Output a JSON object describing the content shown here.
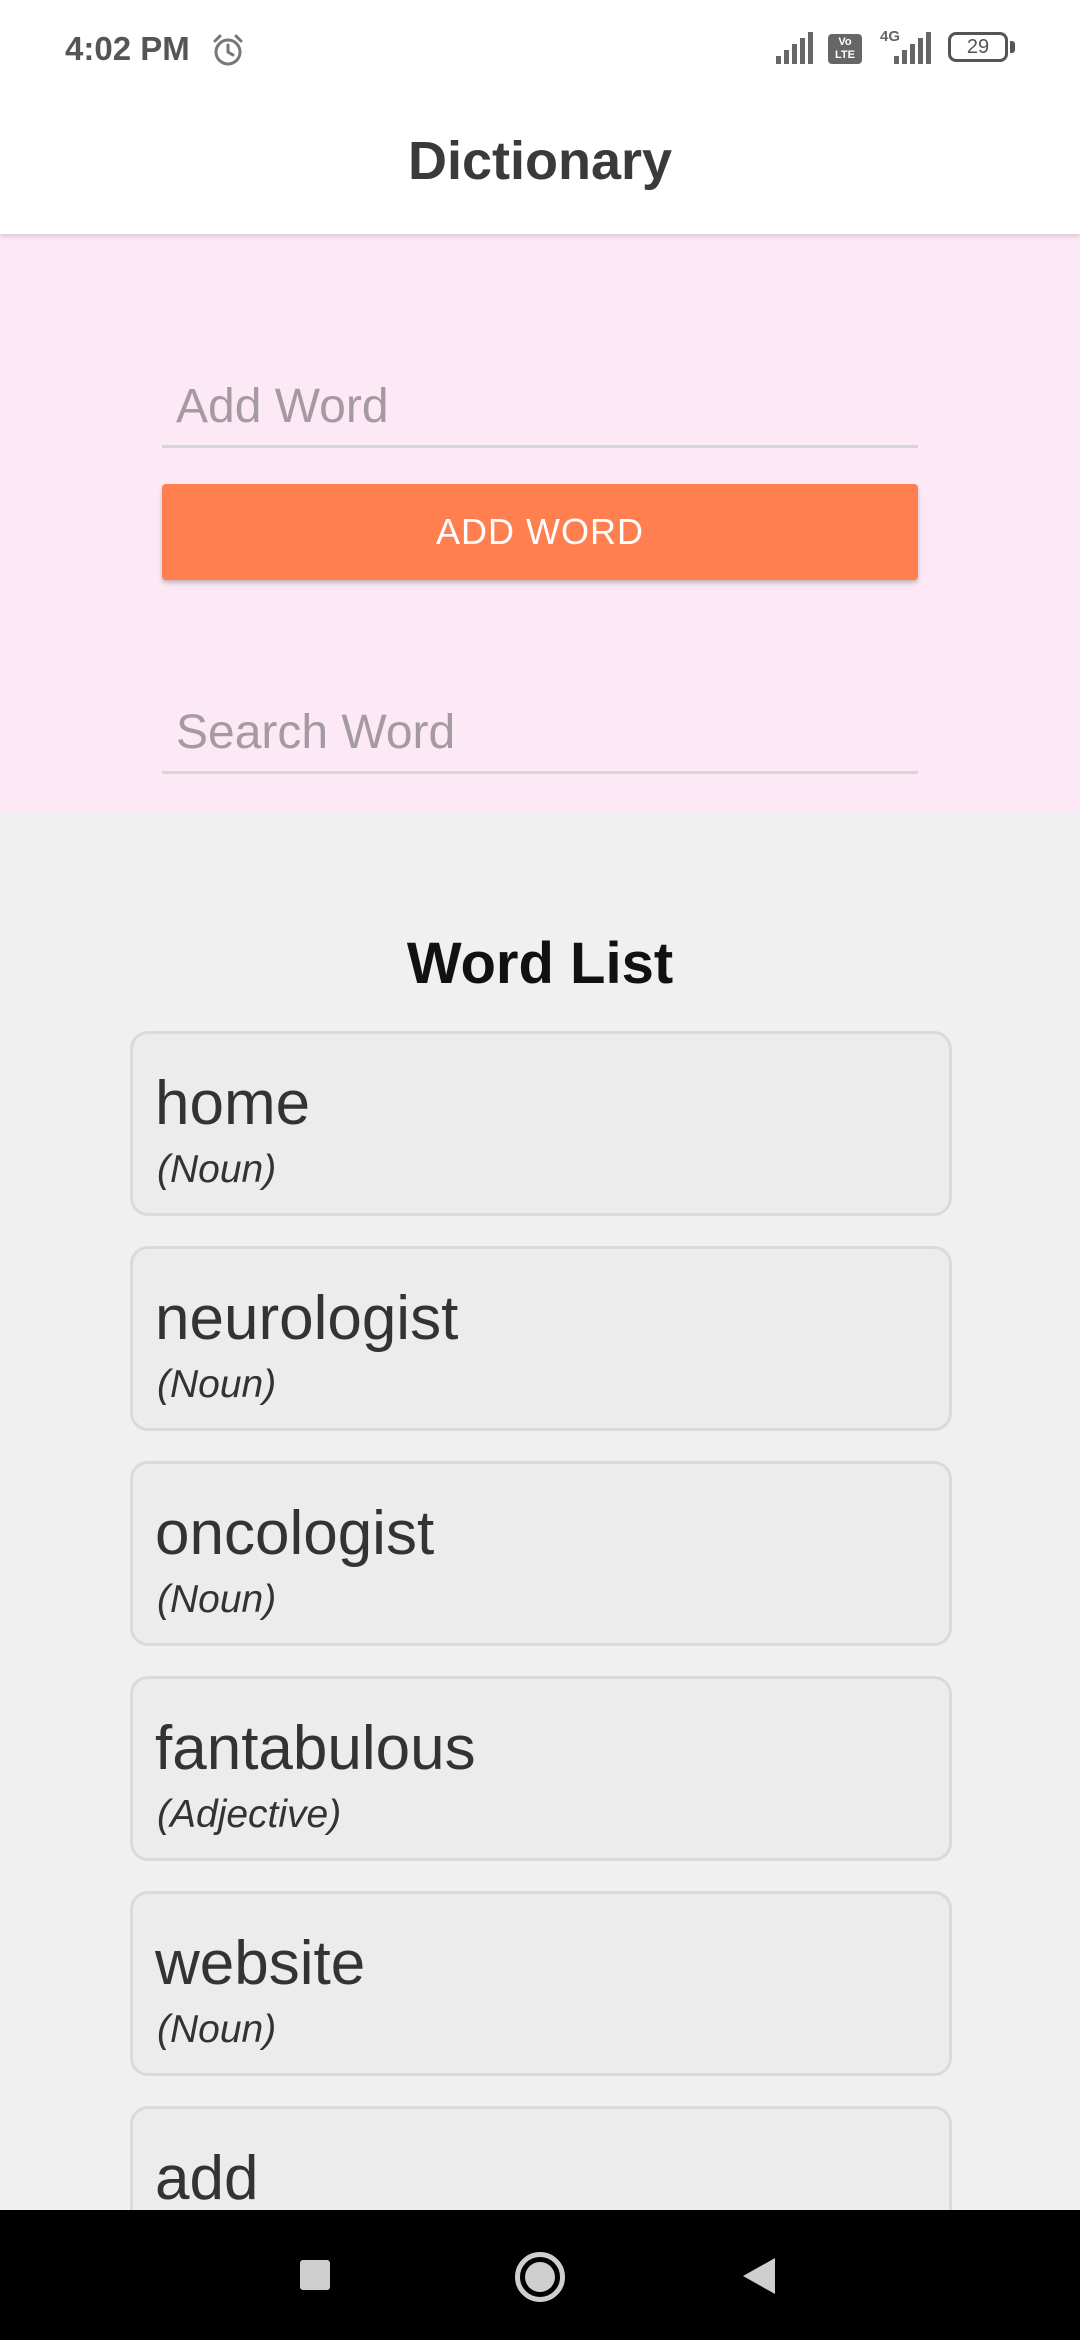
{
  "status_bar": {
    "time": "4:02 PM",
    "volte": "Vo LTE",
    "network": "4G",
    "battery": "29"
  },
  "app_bar": {
    "title": "Dictionary"
  },
  "form": {
    "add_placeholder": "Add Word",
    "add_button_label": "ADD WORD",
    "search_placeholder": "Search Word"
  },
  "list": {
    "title": "Word List",
    "items": [
      {
        "word": "home",
        "type": "(Noun)"
      },
      {
        "word": "neurologist",
        "type": "(Noun)"
      },
      {
        "word": "oncologist",
        "type": "(Noun)"
      },
      {
        "word": "fantabulous",
        "type": "(Adjective)"
      },
      {
        "word": "website",
        "type": "(Noun)"
      },
      {
        "word": "add",
        "type": ""
      }
    ]
  },
  "nav_bar": {
    "icons": [
      "recents-icon",
      "home-icon",
      "back-icon"
    ]
  },
  "colors": {
    "accent": "#ff7f50",
    "panel": "#fce9f5",
    "background": "#f0f0f0"
  }
}
